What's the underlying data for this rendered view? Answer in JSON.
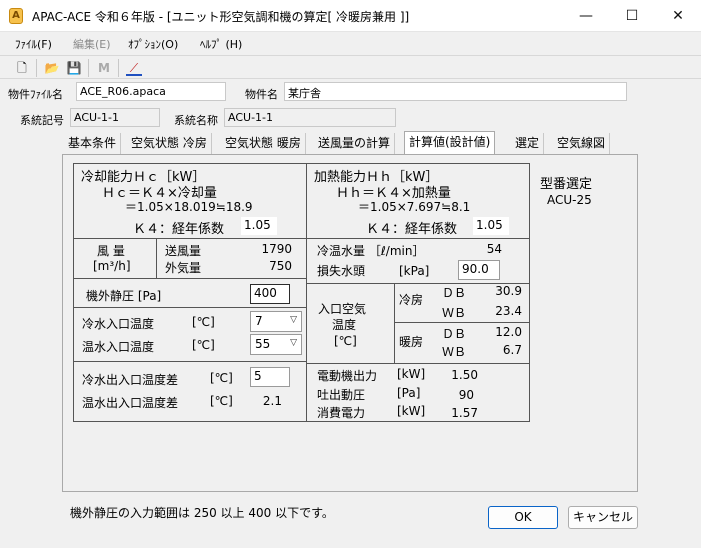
{
  "window": {
    "title": "APAC-ACE 令和６年版 - [ユニット形空気調和機の算定[ 冷暖房兼用 ]]",
    "icon_glyph": "A",
    "minimize_glyph": "—",
    "maximize_glyph": "☐",
    "close_glyph": "✕"
  },
  "menu": [
    "ﾌｧｲﾙ(F)",
    "編集(E)",
    "ｵﾌﾟｼｮﾝ(O)",
    "ﾍﾙﾌﾟ (H)"
  ],
  "toolbar": {
    "icons": [
      "new-file-icon",
      "open-folder-icon",
      "save-icon",
      "binoculars-icon",
      "chart-icon"
    ],
    "glyphs": [
      "🗋",
      "📂",
      "💾",
      "M",
      "⟋"
    ]
  },
  "project": {
    "file_label": "物件ﾌｧｲﾙ名",
    "file_value": "ACE_R06.apaca",
    "name_label": "物件名",
    "name_value": "某庁舎"
  },
  "system": {
    "code_label": "系統記号",
    "code_value": "ACU-1-1",
    "name_label": "系統名称",
    "name_value": "ACU-1-1"
  },
  "tabs": [
    "基本条件",
    "空気状態 冷房",
    "空気状態 暖房",
    "送風量の計算",
    "計算値(設計値)",
    "選定",
    "空気線図"
  ],
  "active_tab": 4,
  "cooling": {
    "title": "冷却能力Ｈｃ［kW］",
    "formula1": "Ｈｃ＝Ｋ４×冷却量",
    "formula2": "＝1.05×18.019≒18.9",
    "k4_label": "Ｋ４：経年係数",
    "k4_value": "1.05"
  },
  "heating": {
    "title": "加熱能力Ｈｈ［kW］",
    "formula1": "Ｈｈ＝Ｋ４×加熱量",
    "formula2": "＝1.05×7.697≒8.1",
    "k4_label": "Ｋ４：経年係数",
    "k4_value": "1.05"
  },
  "model": {
    "label": "型番選定",
    "value": "ACU-25"
  },
  "airflow": {
    "label1": "風 量",
    "label2": "[m³/h]",
    "supply_label": "送風量",
    "supply_value": "1790",
    "outdoor_label": "外気量",
    "outdoor_value": "750"
  },
  "static_pressure": {
    "label": "機外静圧 [Pa]",
    "value": "400"
  },
  "chilled_water": {
    "flow_label": "冷温水量 ［ℓ/min］",
    "flow_value": "54",
    "head_label": "損失水頭",
    "head_unit": "[kPa]",
    "head_value": "90.0"
  },
  "water_temps": {
    "cold_in_label": "冷水入口温度",
    "cold_in_unit": "[℃]",
    "cold_in_value": "7",
    "hot_in_label": "温水入口温度",
    "hot_in_unit": "[℃]",
    "hot_in_value": "55",
    "cold_diff_label": "冷水出入口温度差",
    "cold_diff_unit": "[℃]",
    "cold_diff_value": "5",
    "hot_diff_label": "温水出入口温度差",
    "hot_diff_unit": "[℃]",
    "hot_diff_value": "2.1"
  },
  "inlet_air": {
    "label1": "入口空気",
    "label2": "温度",
    "label3": "[℃]",
    "cooling_label": "冷房",
    "heating_label": "暖房",
    "db_label": "ＤＢ",
    "wb_label": "ＷＢ",
    "cooling_db": "30.9",
    "cooling_wb": "23.4",
    "heating_db": "12.0",
    "heating_wb": "6.7"
  },
  "motor": {
    "output_label": "電動機出力",
    "output_unit": "[kW]",
    "output_value": "1.50",
    "discharge_label": "吐出動圧",
    "discharge_unit": "[Pa]",
    "discharge_value": "90",
    "power_label": "消費電力",
    "power_unit": "[kW]",
    "power_value": "1.57"
  },
  "status_message": "機外静圧の入力範囲は 250 以上 400 以下です。",
  "buttons": {
    "ok": "OK",
    "cancel": "キャンセル"
  }
}
